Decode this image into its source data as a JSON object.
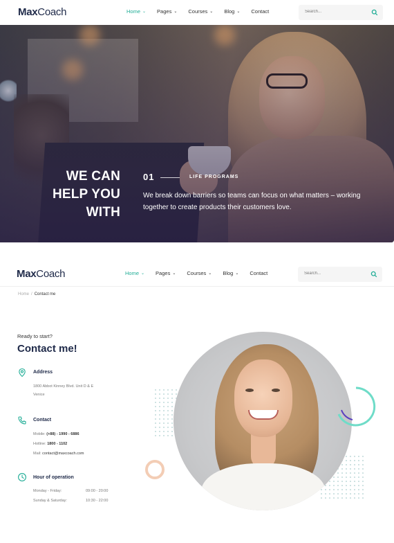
{
  "brand": {
    "part1": "Max",
    "part2": "Coach"
  },
  "nav": {
    "items": [
      {
        "label": "Home",
        "active": true,
        "caret": true
      },
      {
        "label": "Pages",
        "active": false,
        "caret": true
      },
      {
        "label": "Courses",
        "active": false,
        "caret": true
      },
      {
        "label": "Blog",
        "active": false,
        "caret": true
      },
      {
        "label": "Contact",
        "active": false,
        "caret": false
      }
    ],
    "search_placeholder": "Search...",
    "caret_glyph": "⌄"
  },
  "hero": {
    "headline_lines": [
      "WE CAN",
      "HELP YOU",
      "WITH"
    ],
    "number": "01",
    "program_label": "LIFE PROGRAMS",
    "description": "We break down barriers so teams can focus on what matters – working together to create products their customers love."
  },
  "breadcrumb": {
    "home": "Home",
    "separator": "/",
    "current": "Contact me"
  },
  "contact": {
    "eyebrow": "Ready to start?",
    "title": "Contact me!",
    "address": {
      "heading": "Address",
      "lines": [
        "1800 Abbot Kinney Blvd. Unit D & E",
        "Venice"
      ]
    },
    "contact_info": {
      "heading": "Contact",
      "mobile_label": "Mobile:",
      "mobile": "(+88) - 1990 - 6886",
      "hotline_label": "Hotline:",
      "hotline": "1800 - 1102",
      "mail_label": "Mail:",
      "mail": "contact@maxcoach.com"
    },
    "hours": {
      "heading": "Hour of operation",
      "rows": [
        {
          "days": "Monday - Friday:",
          "time": "09:00 - 20:00"
        },
        {
          "days": "Sunday & Saturday:",
          "time": "10:30 - 22:00"
        }
      ]
    }
  },
  "colors": {
    "accent": "#20ad96",
    "navy": "#202b4a",
    "peach": "#f3cdb5",
    "purple": "#5a3fc0"
  }
}
